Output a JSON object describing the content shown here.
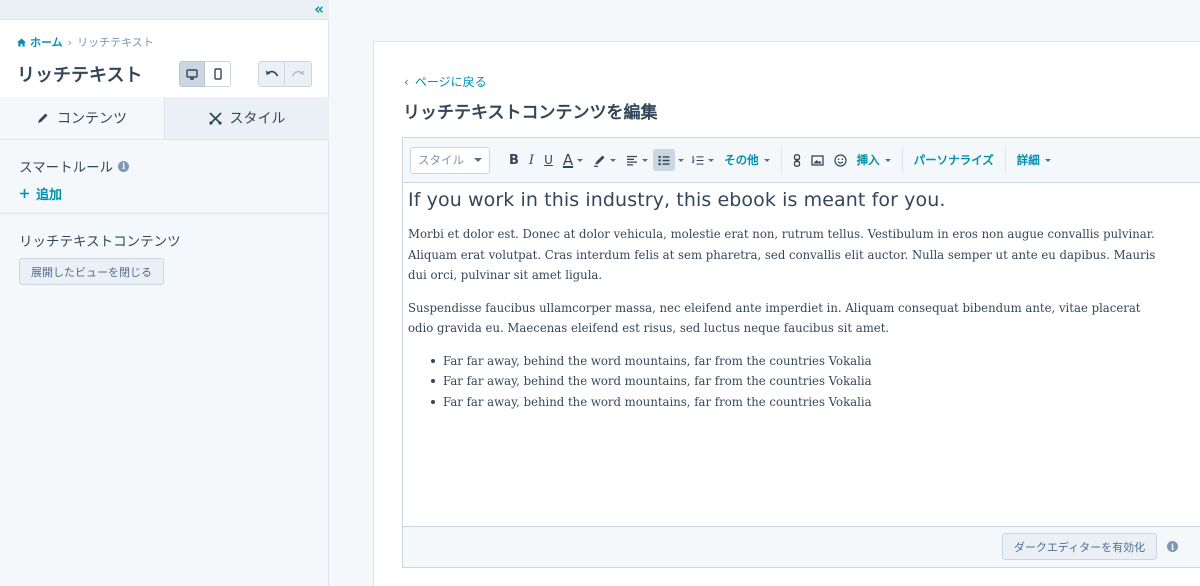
{
  "sidebar": {
    "breadcrumb": {
      "home": "ホーム",
      "separator": "›",
      "current": "リッチテキスト"
    },
    "title": "リッチテキスト",
    "tabs": [
      {
        "label": "コンテンツ",
        "icon": "pencil-icon"
      },
      {
        "label": "スタイル",
        "icon": "scissors-icon"
      }
    ],
    "smart_rules": {
      "label": "スマートルール",
      "add_label": "追加"
    },
    "rich_text_section": {
      "label": "リッチテキストコンテンツ",
      "collapse_button": "展開したビューを閉じる"
    }
  },
  "main": {
    "back_label": "ページに戻る",
    "title": "リッチテキストコンテンツを編集",
    "toolbar": {
      "style_placeholder": "スタイル",
      "bold": "B",
      "italic": "I",
      "underline": "U",
      "text_color": "A",
      "more_label": "その他",
      "insert_label": "挿入",
      "personalize_label": "パーソナライズ",
      "advanced_label": "詳細"
    },
    "content": {
      "heading": "If you work in this industry, this ebook is meant for you.",
      "paragraphs": [
        "Morbi et dolor est. Donec at dolor vehicula, molestie erat non, rutrum tellus. Vestibulum in eros non augue convallis pulvinar. Aliquam erat volutpat. Cras interdum felis at sem pharetra, sed convallis elit auctor. Nulla semper ut ante eu dapibus. Mauris dui orci, pulvinar sit amet ligula.",
        "Suspendisse faucibus ullamcorper massa, nec eleifend ante imperdiet in. Aliquam consequat bibendum ante, vitae placerat odio gravida eu. Maecenas eleifend est risus, sed luctus neque faucibus sit amet."
      ],
      "list_items": [
        "Far far away, behind the word mountains, far from the countries Vokalia",
        "Far far away, behind the word mountains, far from the countries Vokalia",
        "Far far away, behind the word mountains, far from the countries Vokalia"
      ]
    },
    "footer": {
      "dark_editor_button": "ダークエディターを有効化"
    }
  },
  "colors": {
    "accent": "#0091ae",
    "text": "#33475b",
    "border": "#cbd6e2",
    "panel_bg": "#f5f8fa"
  }
}
